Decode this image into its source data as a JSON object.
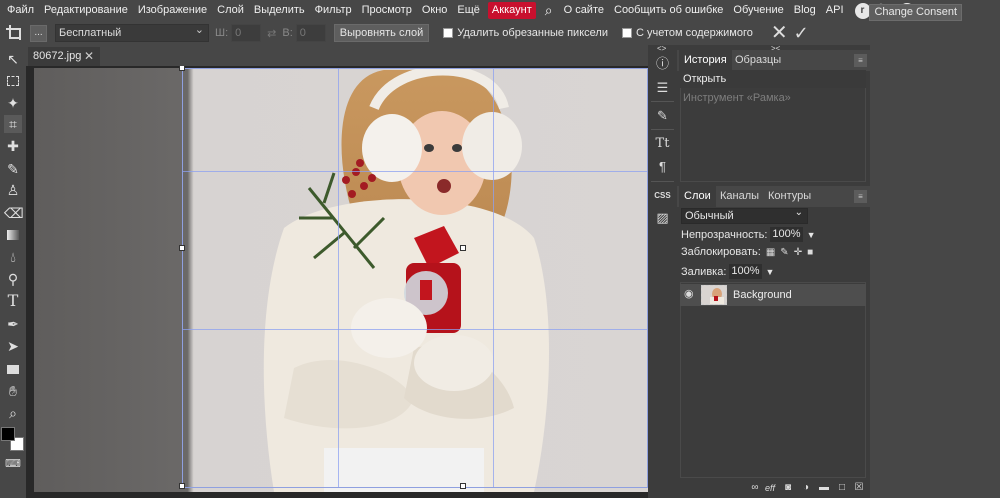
{
  "menu": {
    "items": [
      "Файл",
      "Редактирование",
      "Изображение",
      "Слой",
      "Выделить",
      "Фильтр",
      "Просмотр",
      "Окно",
      "Ещё"
    ],
    "account": "Аккаунт",
    "links": [
      "О сайте",
      "Сообщить об ошибке",
      "Обучение",
      "Blog",
      "API"
    ],
    "icons": [
      "search-icon",
      "reddit-icon",
      "twitter-icon",
      "facebook-icon"
    ],
    "consent": "Change Consent"
  },
  "options": {
    "more": "...",
    "preset": "Бесплатный",
    "width_label": "Ш:",
    "width_value": "0",
    "height_label": "В:",
    "height_value": "0",
    "swap": "⇄",
    "straighten": "Выровнять слой",
    "delete_cropped": "Удалить обрезанные пиксели",
    "content_aware": "С учетом содержимого",
    "cancel": "✕",
    "commit": "✓"
  },
  "document": {
    "tab_name": "80672.jpg",
    "tab_close": "✕"
  },
  "toolbar": {
    "tools": [
      "move-tool",
      "marquee-tool",
      "magic-wand-tool",
      "crop-tool",
      "healing-tool",
      "brush-tool",
      "stamp-tool",
      "eraser-tool",
      "gradient-tool",
      "blur-tool",
      "dodge-tool",
      "type-tool",
      "pen-tool",
      "path-select-tool",
      "shape-tool",
      "hand-tool",
      "zoom-tool"
    ],
    "active": "crop-tool",
    "foreground": "#000000",
    "background": "#ffffff"
  },
  "history_panel": {
    "tabs": [
      "История",
      "Образцы"
    ],
    "items": [
      "Открыть",
      "Инструмент «Рамка»"
    ]
  },
  "layers_panel": {
    "tabs": [
      "Слои",
      "Каналы",
      "Контуры"
    ],
    "blend_mode": "Обычный",
    "opacity_label": "Непрозрачность:",
    "opacity_value": "100%",
    "lock_label": "Заблокировать:",
    "fill_label": "Заливка:",
    "fill_value": "100%",
    "layers": [
      {
        "name": "Background"
      }
    ],
    "footer_icons": [
      "link-icon",
      "effects-icon",
      "mask-icon",
      "adjustment-icon",
      "folder-icon",
      "new-layer-icon",
      "trash-icon"
    ],
    "footer_fx": "eff"
  },
  "mini_panel": {
    "arrows": "<>",
    "icons": [
      "info-icon",
      "adjustments-icon",
      "brush-settings-icon",
      "character-icon",
      "paragraph-icon",
      "css-icon",
      "image-icon"
    ]
  },
  "collapse_arrows": "><"
}
